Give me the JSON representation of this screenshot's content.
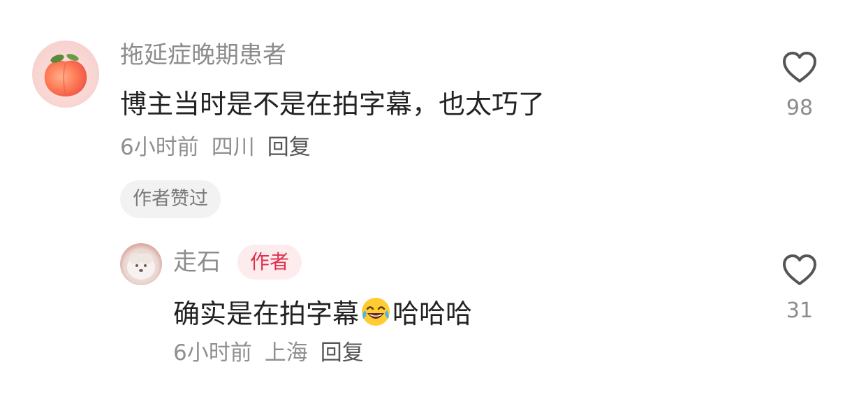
{
  "comments": [
    {
      "username": "拖延症晚期患者",
      "text": "博主当时是不是在拍字幕，也太巧了",
      "time": "6小时前",
      "location": "四川",
      "reply_label": "回复",
      "liked_badge": "作者赞过",
      "likes": "98",
      "avatar_icon": "peach-avatar"
    }
  ],
  "replies": [
    {
      "username": "走石",
      "author_badge": "作者",
      "text_before_emoji": "确实是在拍字幕",
      "emoji_icon": "laughing-tears-emoji",
      "text_after_emoji": "哈哈哈",
      "time": "6小时前",
      "location": "上海",
      "reply_label": "回复",
      "likes": "31",
      "avatar_icon": "white-dog-avatar"
    }
  ],
  "colors": {
    "author_badge_text": "#e0304c",
    "author_badge_bg": "#fdecee",
    "meta_text": "#8f8f8f",
    "content_text": "#222222"
  }
}
